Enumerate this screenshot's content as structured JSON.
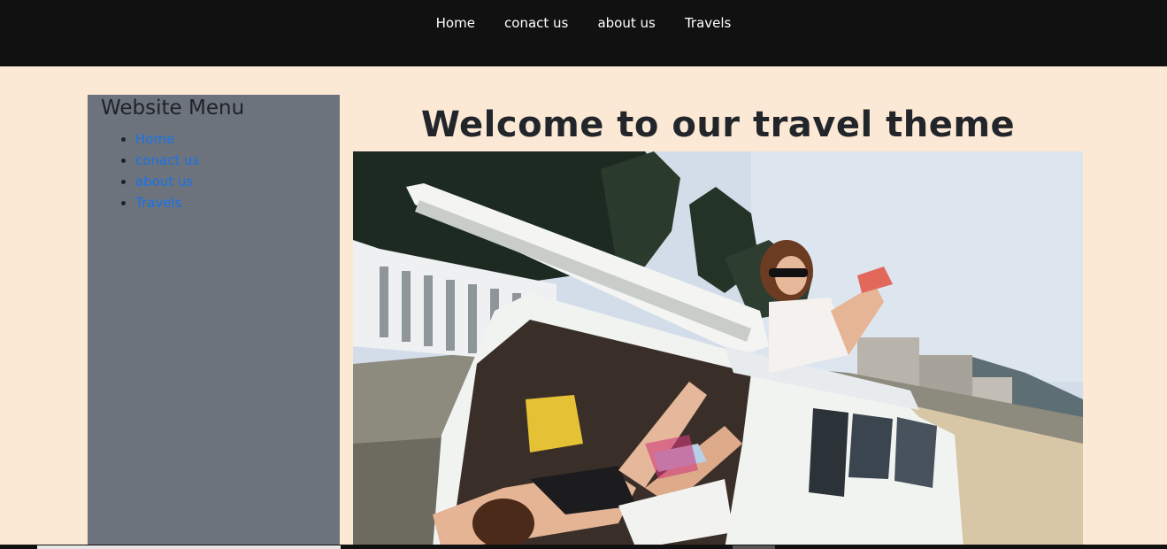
{
  "topnav": {
    "items": [
      {
        "label": "Home"
      },
      {
        "label": "conact us"
      },
      {
        "label": "about us"
      },
      {
        "label": "Travels"
      }
    ]
  },
  "sidebar": {
    "title": "Website Menu",
    "items": [
      {
        "label": "Home"
      },
      {
        "label": "conact us"
      },
      {
        "label": "about us"
      },
      {
        "label": "Travels"
      }
    ]
  },
  "main": {
    "title": "Welcome to our travel theme"
  },
  "colors": {
    "nav_bg": "#111111",
    "page_bg": "#fbe9d5",
    "sidebar_bg": "#6c737d",
    "link": "#1a73e8"
  }
}
